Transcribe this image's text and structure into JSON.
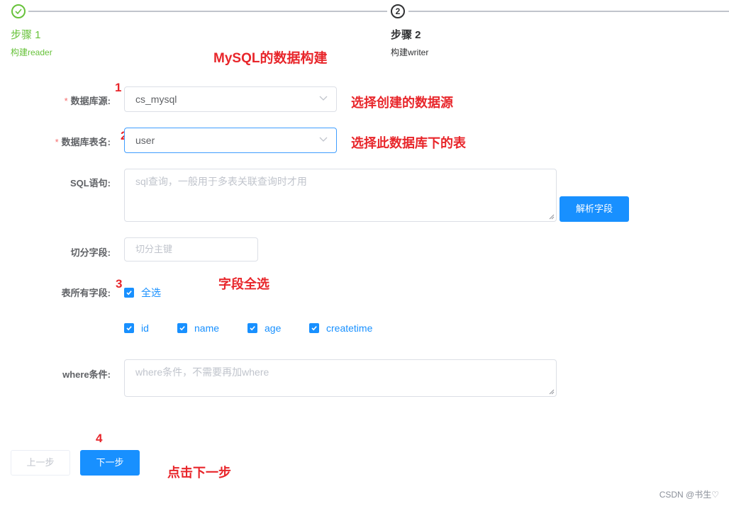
{
  "steps": [
    {
      "title": "步骤 1",
      "desc": "构建reader",
      "status": "success"
    },
    {
      "title": "步骤 2",
      "desc": "构建writer",
      "status": "process",
      "number": "2"
    }
  ],
  "annotations": {
    "heading": "MySQL的数据构建",
    "n1": "1",
    "n2": "2",
    "n3": "3",
    "n4": "4",
    "datasource_hint": "选择创建的数据源",
    "table_hint": "选择此数据库下的表",
    "fields_hint": "字段全选",
    "next_hint": "点击下一步"
  },
  "form": {
    "required_mark": "*",
    "datasource_label": "数据库源:",
    "datasource_value": "cs_mysql",
    "table_label": "数据库表名:",
    "table_value": "user",
    "sql_label": "SQL语句:",
    "sql_placeholder": "sql查询，一般用于多表关联查询时才用",
    "parse_button": "解析字段",
    "split_label": "切分字段:",
    "split_placeholder": "切分主键",
    "fields_label": "表所有字段:",
    "select_all": "全选",
    "fields": [
      "id",
      "name",
      "age",
      "createtime"
    ],
    "where_label": "where条件:",
    "where_placeholder": "where条件，不需要再加where"
  },
  "nav": {
    "prev": "上一步",
    "next": "下一步"
  },
  "watermark": "CSDN @书生♡",
  "colors": {
    "primary": "#1890ff",
    "success": "#67c23a",
    "annotation": "#e8262b",
    "required": "#f56c6c"
  }
}
